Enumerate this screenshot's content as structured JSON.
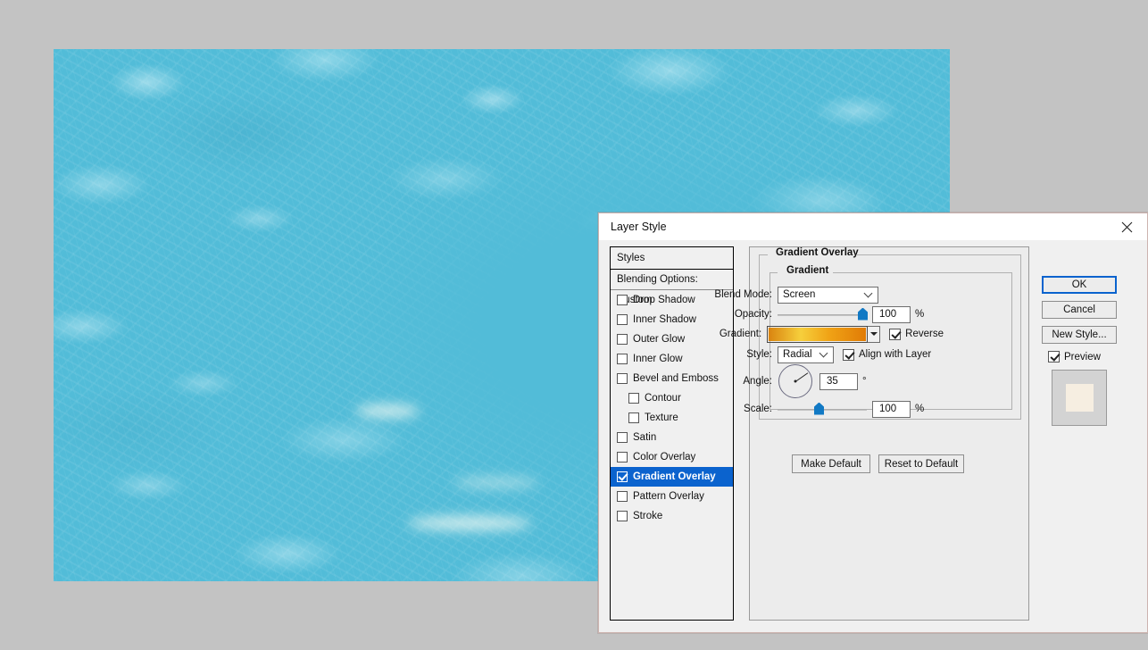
{
  "app": {
    "canvas_background_color": "#52bcd8",
    "desktop_color": "#c3c3c3"
  },
  "dialog": {
    "title": "Layer Style",
    "close_icon": "close-icon"
  },
  "styles_list": {
    "header": "Styles",
    "blending_options": "Blending Options: Custom",
    "items": [
      {
        "label": "Drop Shadow",
        "checked": false,
        "indent": false,
        "selected": false
      },
      {
        "label": "Inner Shadow",
        "checked": false,
        "indent": false,
        "selected": false
      },
      {
        "label": "Outer Glow",
        "checked": false,
        "indent": false,
        "selected": false
      },
      {
        "label": "Inner Glow",
        "checked": false,
        "indent": false,
        "selected": false
      },
      {
        "label": "Bevel and Emboss",
        "checked": false,
        "indent": false,
        "selected": false
      },
      {
        "label": "Contour",
        "checked": false,
        "indent": true,
        "selected": false
      },
      {
        "label": "Texture",
        "checked": false,
        "indent": true,
        "selected": false
      },
      {
        "label": "Satin",
        "checked": false,
        "indent": false,
        "selected": false
      },
      {
        "label": "Color Overlay",
        "checked": false,
        "indent": false,
        "selected": false
      },
      {
        "label": "Gradient Overlay",
        "checked": true,
        "indent": false,
        "selected": true
      },
      {
        "label": "Pattern Overlay",
        "checked": false,
        "indent": false,
        "selected": false
      },
      {
        "label": "Stroke",
        "checked": false,
        "indent": false,
        "selected": false
      }
    ]
  },
  "settings": {
    "group_title": "Gradient Overlay",
    "subgroup_title": "Gradient",
    "blend_mode": {
      "label": "Blend Mode:",
      "value": "Screen"
    },
    "opacity": {
      "label": "Opacity:",
      "value": "100",
      "unit": "%",
      "percent": 100
    },
    "gradient": {
      "label": "Gradient:",
      "stops": [
        "#d98410",
        "#f6cf3c",
        "#f0a316",
        "#e07b06"
      ],
      "reverse_label": "Reverse",
      "reverse_checked": true
    },
    "style": {
      "label": "Style:",
      "value": "Radial",
      "align_label": "Align with Layer",
      "align_checked": true
    },
    "angle": {
      "label": "Angle:",
      "value": "35",
      "unit": "°",
      "degrees": 35
    },
    "scale": {
      "label": "Scale:",
      "value": "100",
      "unit": "%",
      "percent": 46
    },
    "make_default": "Make Default",
    "reset_to_default": "Reset to Default"
  },
  "buttons": {
    "ok": "OK",
    "cancel": "Cancel",
    "new_style": "New Style...",
    "preview_label": "Preview",
    "preview_checked": true,
    "preview_thumb_color": "#f6eee1"
  }
}
